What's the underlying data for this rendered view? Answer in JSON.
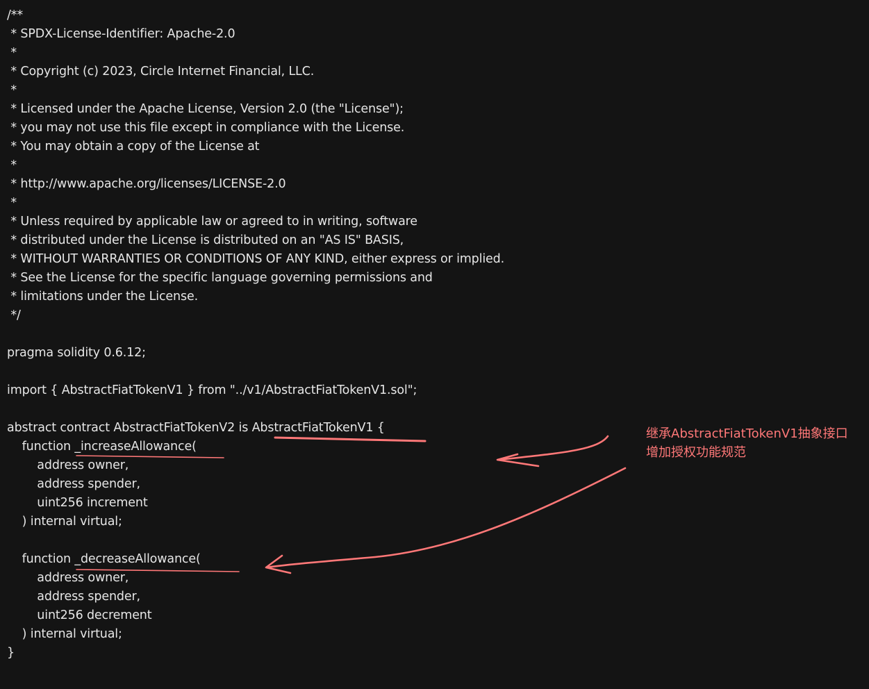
{
  "code_lines": [
    "/**",
    " * SPDX-License-Identifier: Apache-2.0",
    " *",
    " * Copyright (c) 2023, Circle Internet Financial, LLC.",
    " *",
    " * Licensed under the Apache License, Version 2.0 (the \"License\");",
    " * you may not use this file except in compliance with the License.",
    " * You may obtain a copy of the License at",
    " *",
    " * http://www.apache.org/licenses/LICENSE-2.0",
    " *",
    " * Unless required by applicable law or agreed to in writing, software",
    " * distributed under the License is distributed on an \"AS IS\" BASIS,",
    " * WITHOUT WARRANTIES OR CONDITIONS OF ANY KIND, either express or implied.",
    " * See the License for the specific language governing permissions and",
    " * limitations under the License.",
    " */",
    "",
    "pragma solidity 0.6.12;",
    "",
    "import { AbstractFiatTokenV1 } from \"../v1/AbstractFiatTokenV1.sol\";",
    "",
    "abstract contract AbstractFiatTokenV2 is AbstractFiatTokenV1 {",
    "    function _increaseAllowance(",
    "        address owner,",
    "        address spender,",
    "        uint256 increment",
    "    ) internal virtual;",
    "",
    "    function _decreaseAllowance(",
    "        address owner,",
    "        address spender,",
    "        uint256 decrement",
    "    ) internal virtual;",
    "}"
  ],
  "annotation": {
    "line1": "继承AbstractFiatTokenV1抽象接口",
    "line2": "增加授权功能规范"
  },
  "colors": {
    "background": "#141414",
    "text": "#e6e6e6",
    "annotation": "#ff7878"
  }
}
